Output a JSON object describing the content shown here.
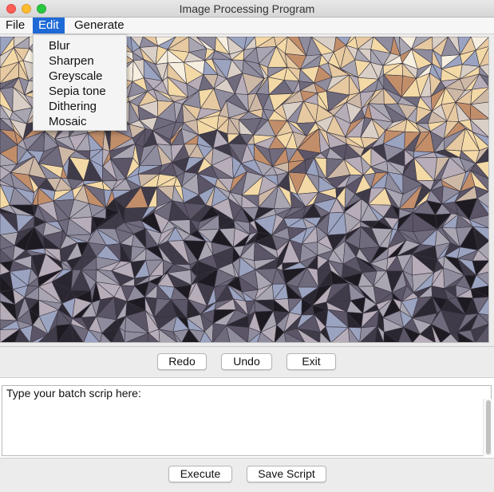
{
  "window": {
    "title": "Image Processing Program"
  },
  "menubar": {
    "items": [
      {
        "label": "File"
      },
      {
        "label": "Edit"
      },
      {
        "label": "Generate"
      }
    ]
  },
  "edit_menu": {
    "items": [
      {
        "label": "Blur"
      },
      {
        "label": "Sharpen"
      },
      {
        "label": "Greyscale"
      },
      {
        "label": "Sepia tone"
      },
      {
        "label": "Dithering"
      },
      {
        "label": "Mosaic"
      }
    ]
  },
  "toolbar": {
    "redo_label": "Redo",
    "undo_label": "Undo",
    "exit_label": "Exit"
  },
  "script": {
    "label": "Type your batch scrip here:",
    "value": ""
  },
  "actions": {
    "execute_label": "Execute",
    "save_label": "Save Script"
  },
  "image": {
    "effect": "mosaic",
    "palette": [
      "#f3d9a6",
      "#e6c9a0",
      "#cdb8a6",
      "#a9a6b2",
      "#8f8c9e",
      "#6f6a7c",
      "#5b5567",
      "#403b48",
      "#2b2731",
      "#1d1a22",
      "#b7adb8",
      "#d9cfc6",
      "#f6efe0",
      "#9aa3c0",
      "#c28e6a"
    ]
  }
}
